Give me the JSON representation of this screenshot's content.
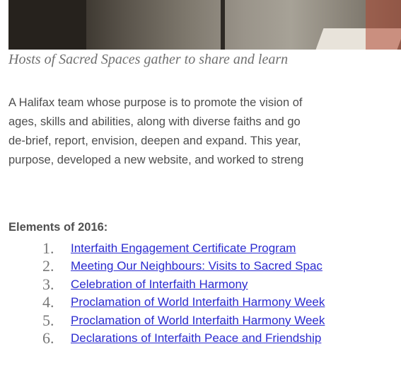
{
  "photo": {
    "alt": "group photo (cropped)"
  },
  "caption": "Hosts of Sacred Spaces gather to share and learn",
  "paragraph_lines": [
    "A Halifax team whose purpose is to promote the vision of",
    "ages, skills and abilities, along with diverse faiths and go",
    "de-brief, report, envision, deepen and expand. This year,",
    "purpose, developed a new website, and worked to streng"
  ],
  "elements_heading": "Elements of 2016:",
  "elements": [
    {
      "num": "1.",
      "label": "Interfaith Engagement Certificate Program"
    },
    {
      "num": "2.",
      "label": "Meeting Our Neighbours: Visits to Sacred Spac"
    },
    {
      "num": "3.",
      "label": "Celebration of Interfaith Harmony"
    },
    {
      "num": "4.",
      "label": "Proclamation of World Interfaith Harmony Week"
    },
    {
      "num": "5.",
      "label": "Proclamation of World Interfaith Harmony Week"
    },
    {
      "num": "6.",
      "label": "Declarations of Interfaith Peace and Friendship"
    }
  ]
}
